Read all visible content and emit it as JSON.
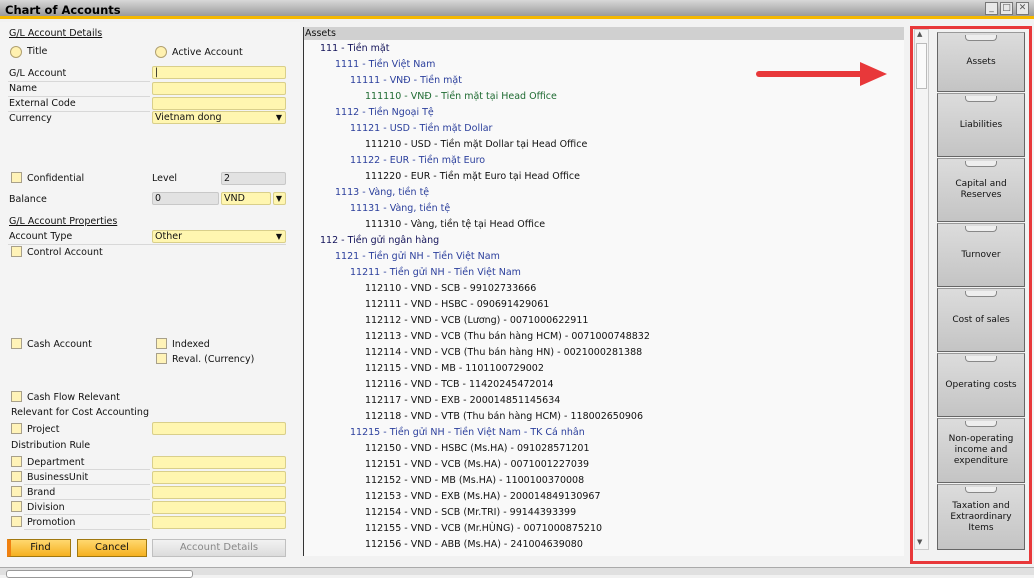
{
  "window": {
    "title": "Chart of Accounts",
    "minimize": "_",
    "maximize": "□",
    "close": "✕"
  },
  "form": {
    "details_title": "G/L Account Details",
    "radio_title": "Title",
    "radio_active": "Active Account",
    "gl_account_label": "G/L Account",
    "gl_account_value": "|",
    "name_label": "Name",
    "external_code_label": "External Code",
    "currency_label": "Currency",
    "currency_value": "Vietnam dong",
    "confidential_label": "Confidential",
    "level_label": "Level",
    "level_value": "2",
    "balance_label": "Balance",
    "balance_value": "0",
    "balance_currency": "VND",
    "properties_title": "G/L Account Properties",
    "account_type_label": "Account Type",
    "account_type_value": "Other",
    "control_account": "Control Account",
    "cash_account": "Cash Account",
    "indexed": "Indexed",
    "reval": "Reval. (Currency)",
    "cash_flow": "Cash Flow Relevant",
    "cost_accounting": "Relevant for Cost Accounting",
    "project": "Project",
    "distribution_rule": "Distribution Rule",
    "dims": [
      "Department",
      "BusinessUnit",
      "Brand",
      "Division",
      "Promotion"
    ],
    "find": "Find",
    "cancel": "Cancel",
    "account_details": "Account Details"
  },
  "tree": {
    "header": "Assets",
    "colors": [
      "#14145a",
      "#2b3f9c",
      "#2b3f9c",
      "#111111"
    ],
    "selected_color": "#1f6b32",
    "rows": [
      {
        "level": 0,
        "text": "111 - Tiền mặt"
      },
      {
        "level": 1,
        "text": "1111 - Tiền Việt Nam"
      },
      {
        "level": 2,
        "text": "11111 - VNĐ - Tiền mặt"
      },
      {
        "level": 3,
        "text": "111110 - VNĐ - Tiền mặt tại Head Office",
        "selected": true
      },
      {
        "level": 1,
        "text": "1112 - Tiền Ngoại Tệ"
      },
      {
        "level": 2,
        "text": "11121 - USD - Tiền mặt Dollar"
      },
      {
        "level": 3,
        "text": "111210 - USD - Tiền mặt Dollar tại Head Office"
      },
      {
        "level": 2,
        "text": "11122 - EUR - Tiền mặt Euro"
      },
      {
        "level": 3,
        "text": "111220 - EUR - Tiền mặt Euro tại Head Office"
      },
      {
        "level": 1,
        "text": "1113 - Vàng, tiền tệ"
      },
      {
        "level": 2,
        "text": "11131 - Vàng, tiền tệ"
      },
      {
        "level": 3,
        "text": "111310 - Vàng, tiền tệ tại Head Office"
      },
      {
        "level": 0,
        "text": "112 - Tiền gửi ngân hàng"
      },
      {
        "level": 1,
        "text": "1121 - Tiền gửi NH - Tiền Việt Nam"
      },
      {
        "level": 2,
        "text": "11211 - Tiền gửi NH - Tiền Việt Nam"
      },
      {
        "level": 3,
        "text": "112110 - VND - SCB - 99102733666"
      },
      {
        "level": 3,
        "text": "112111 - VND - HSBC - 090691429061"
      },
      {
        "level": 3,
        "text": "112112 - VND - VCB (Lương) - 0071000622911"
      },
      {
        "level": 3,
        "text": "112113 - VND - VCB (Thu bán hàng HCM) - 0071000748832"
      },
      {
        "level": 3,
        "text": "112114 - VND - VCB (Thu bán hàng HN) - 0021000281388"
      },
      {
        "level": 3,
        "text": "112115 - VND - MB - 1101100729002"
      },
      {
        "level": 3,
        "text": "112116 - VND - TCB - 11420245472014"
      },
      {
        "level": 3,
        "text": "112117 - VND - EXB - 200014851145634"
      },
      {
        "level": 3,
        "text": "112118 - VND - VTB (Thu bán hàng HCM) - 118002650906"
      },
      {
        "level": 2,
        "text": "11215 - Tiền gửi NH - Tiền Việt Nam - TK Cá nhân"
      },
      {
        "level": 3,
        "text": "112150 - VND - HSBC (Ms.HA) - 091028571201"
      },
      {
        "level": 3,
        "text": "112151 - VND - VCB (Ms.HA) - 0071001227039"
      },
      {
        "level": 3,
        "text": "112152 - VND - MB (Ms.HA) - 1100100370008"
      },
      {
        "level": 3,
        "text": "112153 - VND - EXB (Ms.HA) -  200014849130967"
      },
      {
        "level": 3,
        "text": "112154 - VND - SCB (Mr.TRI) -  99144393399"
      },
      {
        "level": 3,
        "text": "112155 - VND - VCB (Mr.HÙNG) - 0071000875210"
      },
      {
        "level": 3,
        "text": "112156 - VND - ABB (Ms.HA) - 241004639080"
      }
    ]
  },
  "drawers": [
    "Assets",
    "Liabilities",
    "Capital and Reserves",
    "Turnover",
    "Cost of sales",
    "Operating costs",
    "Non-operating income and expenditure",
    "Taxation and Extraordinary Items"
  ]
}
